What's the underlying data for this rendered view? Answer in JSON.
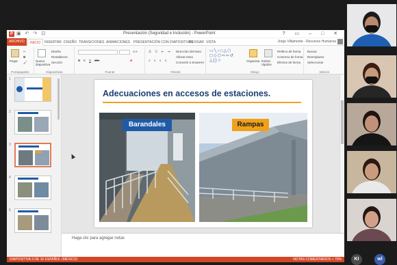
{
  "window": {
    "app_icon": "P",
    "title": "Presentación (Seguridad e Inclusión) - PowerPoint",
    "user_name": "Jorge Villamonte - Recursos Humanos",
    "qat_icons": [
      "save-icon",
      "undo-icon",
      "redo-icon",
      "present-icon"
    ],
    "controls": [
      "?",
      "▭",
      "–",
      "□",
      "✕"
    ]
  },
  "ribbon_tabs": [
    "ARCHIVO",
    "INICIO",
    "INSERTAR",
    "DISEÑO",
    "TRANSICIONES",
    "ANIMACIONES",
    "PRESENTACIÓN CON DIAPOSITIVAS",
    "REVISAR",
    "VISTA"
  ],
  "active_tab": "INICIO",
  "ribbon": {
    "groups": [
      "Portapapeles",
      "Diapositivas",
      "Fuente",
      "Párrafo",
      "Dibujo",
      "Edición"
    ],
    "clipboard": {
      "paste": "Pegar"
    },
    "slides": {
      "new_slide": "Nueva diapositiva",
      "layout": "Diseño",
      "reset": "Restablecer",
      "section": "Sección"
    },
    "font": {
      "bold": "N",
      "italic": "K",
      "underline": "S",
      "strike": "abc",
      "font_color": "A"
    },
    "paragraph": {
      "text_direction": "Dirección del texto",
      "align_text": "Alinear texto",
      "smartart": "Convertir a SmartArt"
    },
    "drawing": {
      "arrange": "Organizar",
      "quick_styles": "Estilos rápidos",
      "fill": "Relleno de forma",
      "outline": "Contorno de forma",
      "effects": "Efectos de forma",
      "shapes_rows": [
        "▭╲○□△⬠",
        "◻◇⬡⇨⇦↺",
        "△{}☆"
      ]
    },
    "editing": {
      "find": "Buscar",
      "replace": "Reemplazar",
      "select": "Seleccionar"
    }
  },
  "thumbnails": {
    "numbers": [
      "1",
      "2",
      "3",
      "4",
      "5"
    ],
    "selected": 3
  },
  "slide": {
    "title": "Adecuaciones en accesos de estaciones.",
    "photos": [
      {
        "label": "Barandales",
        "label_bg": "#1f5aa6",
        "label_color": "#ffffff"
      },
      {
        "label": "Rampas",
        "label_bg": "#f0a11a",
        "label_color": "#1a1a1a"
      }
    ]
  },
  "notes_placeholder": "Haga clic para agregar notas",
  "status": {
    "left": "DIAPOSITIVA 3 DE 16   ESPAÑOL (MÉXICO)",
    "right": "NOTAS   COMENTARIOS        +  70%"
  },
  "colors": {
    "accent": "#d24726",
    "title_blue": "#1e3f72",
    "gold": "#f0a11a"
  },
  "participants": [
    {
      "shirt": "#1e5fb3",
      "skin": "#b98a6c",
      "hair": "#1b1b1b",
      "bg": "#e8e8ea",
      "mask": true
    },
    {
      "shirt": "#262626",
      "skin": "#c79a7d",
      "hair": "#3a1e12",
      "bg": "#d8c6b3",
      "mask": true
    },
    {
      "shirt": "#151515",
      "skin": "#c29178",
      "hair": "#1f140f",
      "bg": "#b8a89a",
      "mask": false
    },
    {
      "shirt": "#e9e9e9",
      "skin": "#c99c80",
      "hair": "#2a1a12",
      "bg": "#c8b79e",
      "mask": false
    },
    {
      "shirt": "#6a4a50",
      "skin": "#d0a188",
      "hair": "#231713",
      "bg": "#d9d4cf",
      "mask": false
    }
  ],
  "meeting_controls": [
    "KI",
    "wl"
  ]
}
